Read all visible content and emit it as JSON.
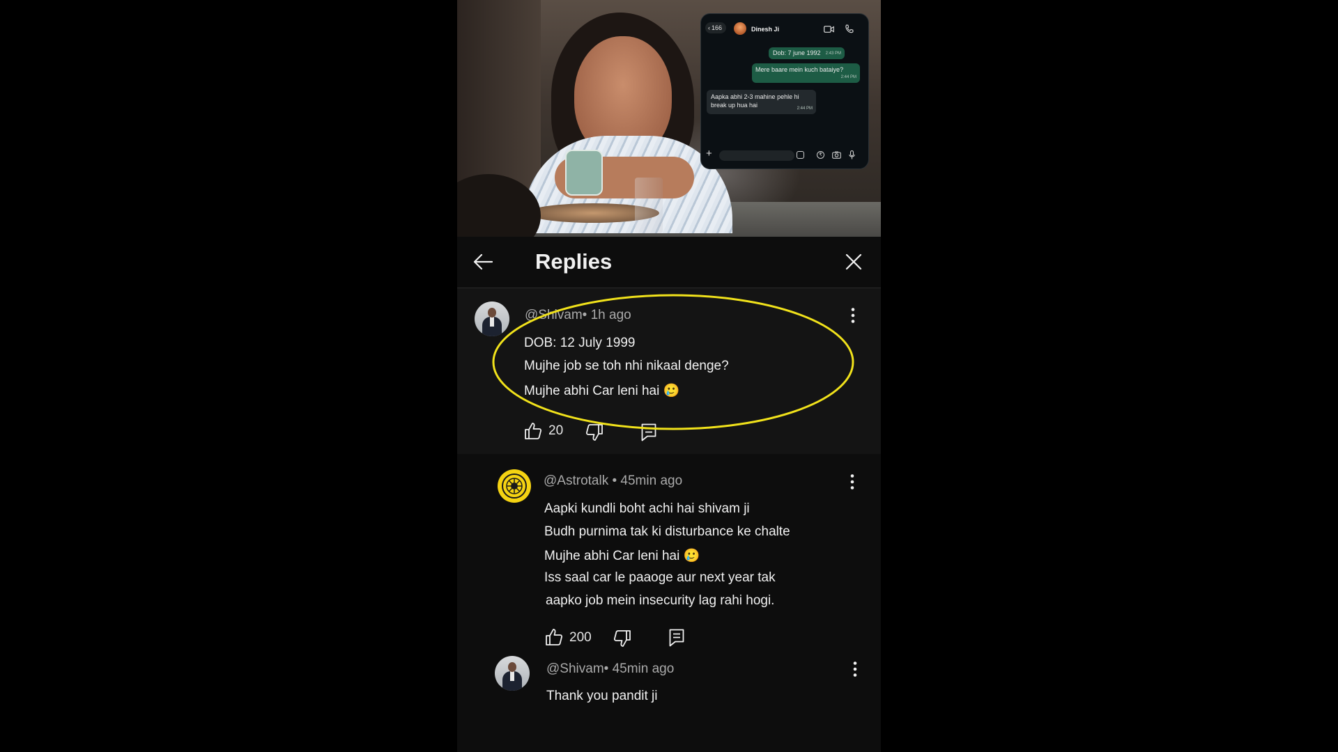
{
  "whatsapp": {
    "back_count": "166",
    "contact_name": "Dinesh Ji",
    "messages": [
      {
        "text": "Dob: 7 june 1992",
        "time": "2:43 PM",
        "direction": "outgoing"
      },
      {
        "text": "Mere baare mein kuch bataiye?",
        "time": "2:44 PM",
        "direction": "outgoing"
      },
      {
        "text": "Aapka abhi 2-3 mahine pehle hi break up hua hai",
        "time": "2:44 PM",
        "direction": "incoming"
      }
    ]
  },
  "header": {
    "title": "Replies"
  },
  "comments": [
    {
      "user": "@Shivam",
      "time": "• 1h ago",
      "lines": [
        "DOB: 12 July 1999",
        "Mujhe job se toh nhi nikaal denge?",
        "Mujhe abhi Car leni hai 🥲"
      ],
      "likes": "20",
      "highlighted": true
    },
    {
      "user": "@Astrotalk",
      "time": "• 45min ago",
      "lines": [
        "Aapki kundli boht achi hai shivam ji",
        "Budh purnima tak ki disturbance ke chalte",
        "Mujhe abhi Car leni hai 🥲",
        "Iss saal car le paaoge aur next year tak",
        "aapko job mein insecurity lag rahi hogi."
      ],
      "likes": "200"
    },
    {
      "user": "@Shivam",
      "time": "• 45min ago",
      "lines": [
        "Thank you pandit ji"
      ]
    }
  ],
  "colors": {
    "highlight_ellipse": "#f1e21b",
    "whatsapp_outgoing": "#1d5c45",
    "astrotalk_logo": "#f5d312",
    "background": "#0d0d0d"
  }
}
